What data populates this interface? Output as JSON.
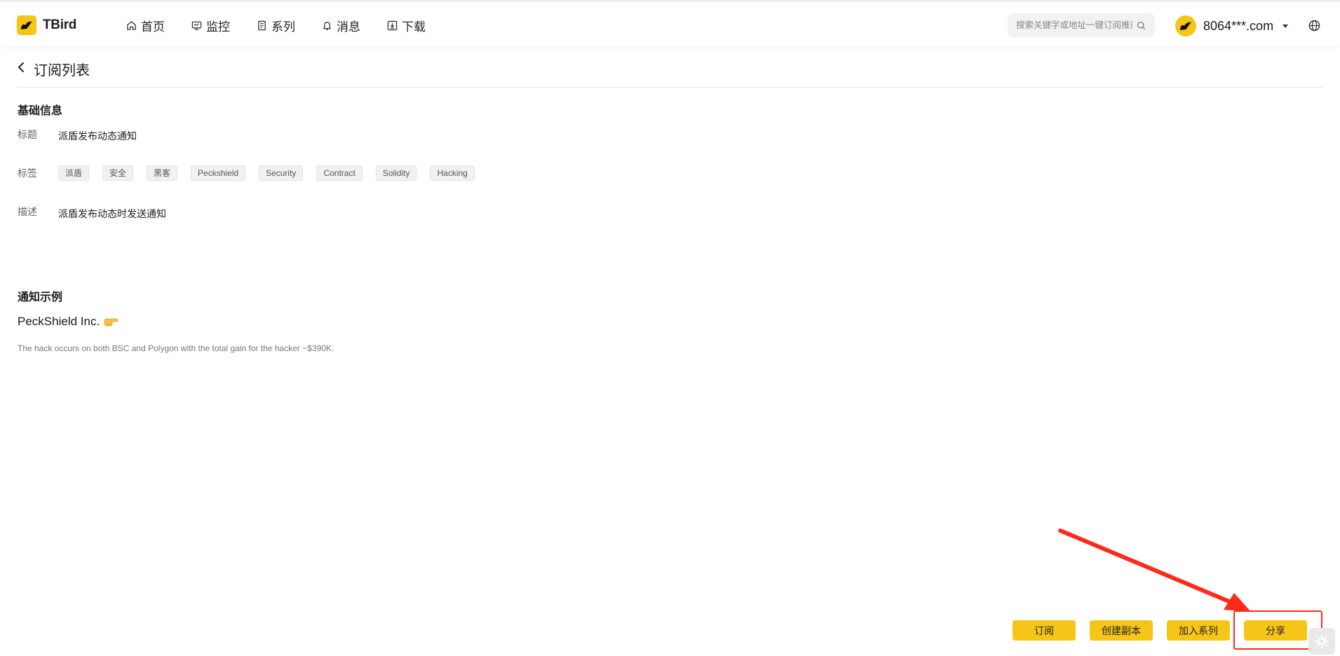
{
  "header": {
    "brand": "TBird",
    "nav": [
      {
        "label": "首页",
        "icon": "home-icon"
      },
      {
        "label": "监控",
        "icon": "monitor-icon"
      },
      {
        "label": "系列",
        "icon": "series-icon"
      },
      {
        "label": "消息",
        "icon": "bell-icon"
      },
      {
        "label": "下载",
        "icon": "download-icon"
      }
    ],
    "search_placeholder": "搜索关键字或地址一键订阅推送",
    "user_name": "8064***.com"
  },
  "page": {
    "title": "订阅列表"
  },
  "basic_info": {
    "section_title": "基础信息",
    "title_label": "标题",
    "title_value": "派盾发布动态通知",
    "tags_label": "标签",
    "tags": [
      "派盾",
      "安全",
      "黑客",
      "Peckshield",
      "Security",
      "Contract",
      "Solidity",
      "Hacking"
    ],
    "description_label": "描述",
    "description_value": "派盾发布动态时发送通知"
  },
  "example": {
    "section_title": "通知示例",
    "source_name": "PeckShield Inc.",
    "body": "The hack occurs on both BSC and Polygon with the total gain for the hacker ~$390K."
  },
  "actions": {
    "subscribe": "订阅",
    "create_copy": "创建副本",
    "add_to_series": "加入系列",
    "share": "分享"
  },
  "colors": {
    "accent": "#f5c518",
    "annotation": "#ff2a1a"
  }
}
